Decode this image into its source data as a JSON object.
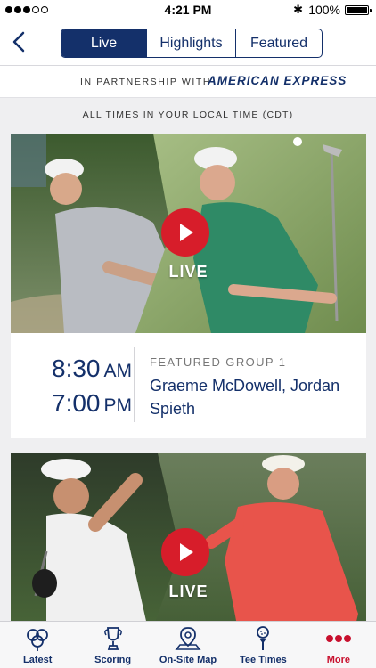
{
  "status_bar": {
    "time": "4:21 PM",
    "battery": "100%",
    "bluetooth": "✱"
  },
  "nav": {
    "back_icon": "chevron-left-icon",
    "tabs": [
      {
        "label": "Live",
        "active": true
      },
      {
        "label": "Highlights",
        "active": false
      },
      {
        "label": "Featured",
        "active": false
      }
    ]
  },
  "partner": {
    "label": "IN PARTNERSHIP WITH",
    "brand": "AMERICAN EXPRESS"
  },
  "timezone_note": "ALL TIMES IN YOUR LOCAL TIME (CDT)",
  "cards": [
    {
      "live_label": "LIVE",
      "times": [
        {
          "time": "8:30",
          "ampm": "AM"
        },
        {
          "time": "7:00",
          "ampm": "PM"
        }
      ],
      "group_label": "FEATURED GROUP 1",
      "players": "Graeme McDowell, Jordan Spieth"
    },
    {
      "live_label": "LIVE"
    }
  ],
  "tabbar": [
    {
      "label": "Latest",
      "icon": "augusta-logo-icon"
    },
    {
      "label": "Scoring",
      "icon": "trophy-icon"
    },
    {
      "label": "On-Site Map",
      "icon": "map-pin-icon"
    },
    {
      "label": "Tee Times",
      "icon": "golf-tee-icon"
    },
    {
      "label": "More",
      "icon": "more-dots-icon"
    }
  ],
  "colors": {
    "navy": "#14306a",
    "accent_red": "#d71d2a",
    "more_red": "#c8102e"
  }
}
